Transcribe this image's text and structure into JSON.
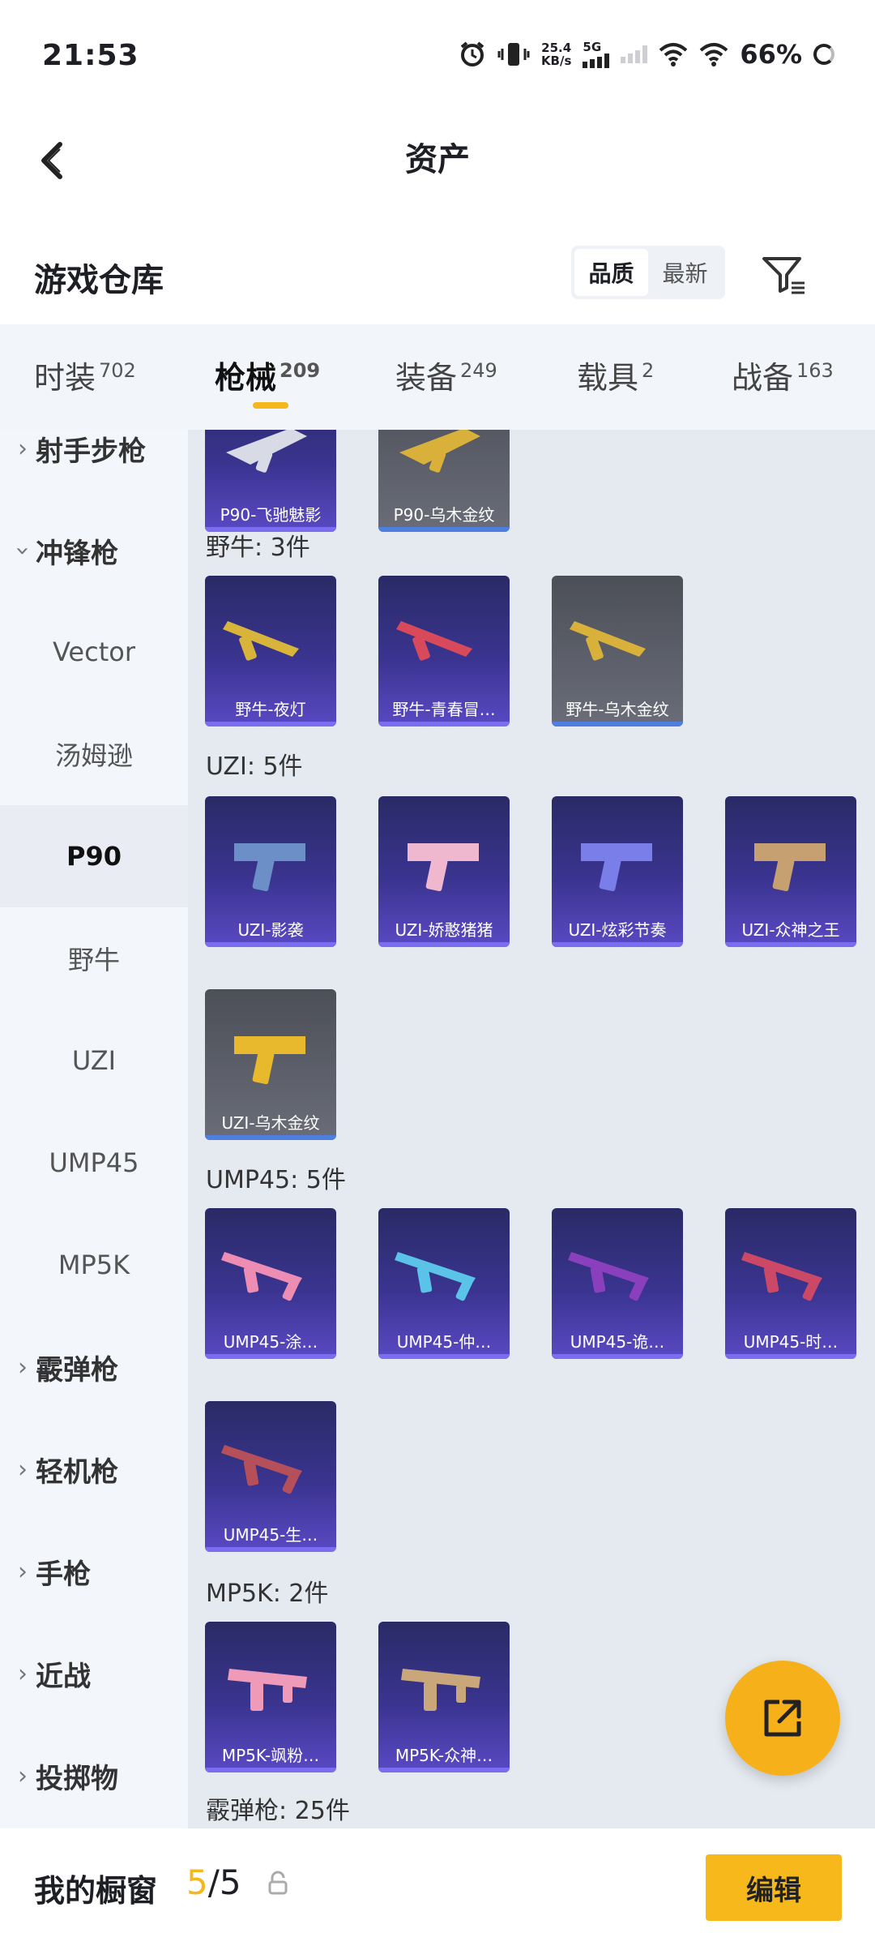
{
  "status_bar": {
    "time": "21:53",
    "net_speed_value": "25.4",
    "net_speed_unit": "KB/s",
    "network_label": "5G",
    "battery": "66%",
    "icons": [
      "alarm-icon",
      "vibrate-icon",
      "signal-icon",
      "wifi-icon",
      "battery-icon"
    ]
  },
  "nav": {
    "title": "资产"
  },
  "header": {
    "title": "游戏仓库",
    "sort_options": [
      "品质",
      "最新"
    ],
    "sort_active": "品质"
  },
  "tabs": [
    {
      "label": "时装",
      "count": "702"
    },
    {
      "label": "枪械",
      "count": "209",
      "active": true
    },
    {
      "label": "装备",
      "count": "249"
    },
    {
      "label": "载具",
      "count": "2"
    },
    {
      "label": "战备",
      "count": "163"
    }
  ],
  "sidebar": {
    "items": [
      {
        "label": "射手步枪",
        "type": "group"
      },
      {
        "label": "冲锋枪",
        "type": "group",
        "expanded": true
      },
      {
        "label": "Vector",
        "type": "sub"
      },
      {
        "label": "汤姆逊",
        "type": "sub"
      },
      {
        "label": "P90",
        "type": "sub",
        "selected": true
      },
      {
        "label": "野牛",
        "type": "sub"
      },
      {
        "label": "UZI",
        "type": "sub"
      },
      {
        "label": "UMP45",
        "type": "sub"
      },
      {
        "label": "MP5K",
        "type": "sub"
      },
      {
        "label": "霰弹枪",
        "type": "group"
      },
      {
        "label": "轻机枪",
        "type": "group"
      },
      {
        "label": "手枪",
        "type": "group"
      },
      {
        "label": "近战",
        "type": "group"
      },
      {
        "label": "投掷物",
        "type": "group"
      }
    ]
  },
  "content": {
    "sections": [
      {
        "label": "",
        "items": [
          {
            "name": "P90-飞驰魅影",
            "rarity": "purple",
            "color": "#d8dbe6"
          },
          {
            "name": "P90-乌木金纹",
            "rarity": "gray",
            "color": "#d8b03a"
          }
        ]
      },
      {
        "label": "野牛: 3件",
        "items": [
          {
            "name": "野牛-夜灯",
            "rarity": "purple",
            "color": "#d9b43a"
          },
          {
            "name": "野牛-青春冒…",
            "rarity": "purple",
            "color": "#d9495c"
          },
          {
            "name": "野牛-乌木金纹",
            "rarity": "gray",
            "color": "#d8b03a"
          }
        ]
      },
      {
        "label": "UZI: 5件",
        "items": [
          {
            "name": "UZI-影袭",
            "rarity": "purple",
            "color": "#6c8fc8"
          },
          {
            "name": "UZI-娇憨猪猪",
            "rarity": "purple",
            "color": "#f0b8cf"
          },
          {
            "name": "UZI-炫彩节奏",
            "rarity": "purple",
            "color": "#7a7ee8"
          },
          {
            "name": "UZI-众神之王",
            "rarity": "purple",
            "color": "#c7a071"
          },
          {
            "name": "UZI-乌木金纹",
            "rarity": "gray",
            "color": "#e8b92d"
          }
        ]
      },
      {
        "label": "UMP45: 5件",
        "items": [
          {
            "name": "UMP45-涂…",
            "rarity": "purple",
            "color": "#ee8db4"
          },
          {
            "name": "UMP45-仲…",
            "rarity": "purple",
            "color": "#5bc3e8"
          },
          {
            "name": "UMP45-诡…",
            "rarity": "purple",
            "color": "#8a3fbd"
          },
          {
            "name": "UMP45-时…",
            "rarity": "purple",
            "color": "#cc4867"
          },
          {
            "name": "UMP45-生…",
            "rarity": "purple",
            "color": "#b5505a"
          }
        ]
      },
      {
        "label": "MP5K: 2件",
        "items": [
          {
            "name": "MP5K-飒粉…",
            "rarity": "purple",
            "color": "#ef9ab8"
          },
          {
            "name": "MP5K-众神…",
            "rarity": "purple",
            "color": "#c9a77a"
          }
        ]
      },
      {
        "label": "霰弹枪: 25件",
        "items": []
      }
    ]
  },
  "bottom_bar": {
    "label": "我的橱窗",
    "count_current": "5",
    "count_sep_total": "/5",
    "edit_label": "编辑"
  },
  "colors": {
    "accent": "#f6b81a",
    "card_purple": "#3a3490",
    "card_gray": "#5e616b"
  }
}
